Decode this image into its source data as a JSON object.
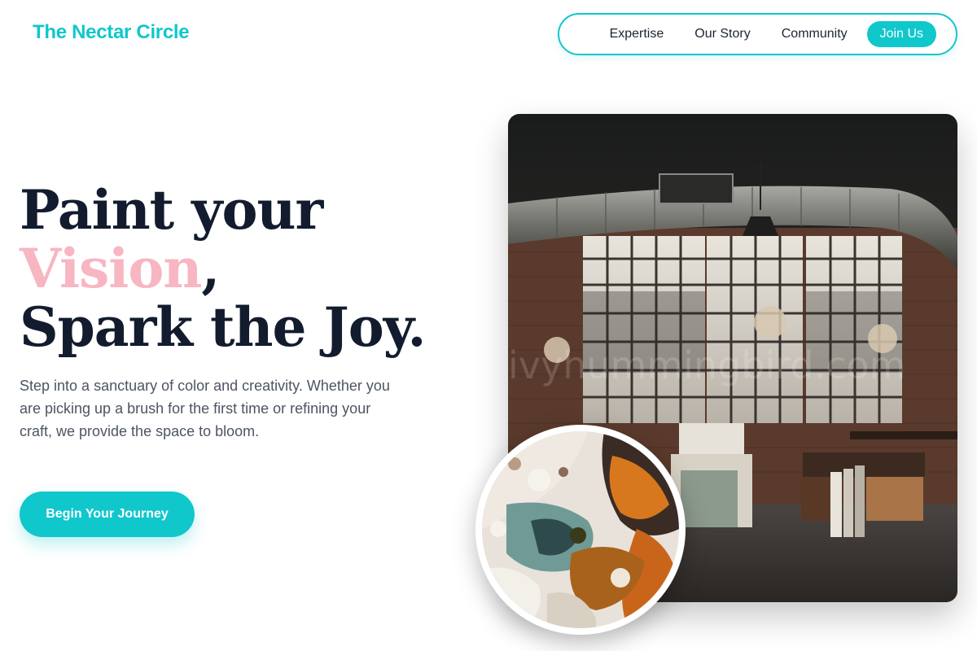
{
  "brand": {
    "name": "The Nectar Circle"
  },
  "nav": {
    "links": [
      "Expertise",
      "Our Story",
      "Community"
    ],
    "cta_label": "Join Us"
  },
  "hero": {
    "headline_line1": "Paint your",
    "headline_accent": "Vision",
    "headline_comma": ",",
    "headline_line3": "Spark the Joy.",
    "lead": "Step into a sanctuary of color and creativity. Whether you are picking up a brush for the first time or refining your craft, we provide the space to bloom.",
    "cta_label": "Begin Your Journey"
  },
  "images": {
    "studio": {
      "icon": "art-studio-photo"
    },
    "palette": {
      "icon": "paint-texture-photo"
    }
  },
  "colors": {
    "accent": "#10c7cc",
    "pink": "#f7b6c2",
    "heading": "#131c2e",
    "body": "#4d5563"
  }
}
